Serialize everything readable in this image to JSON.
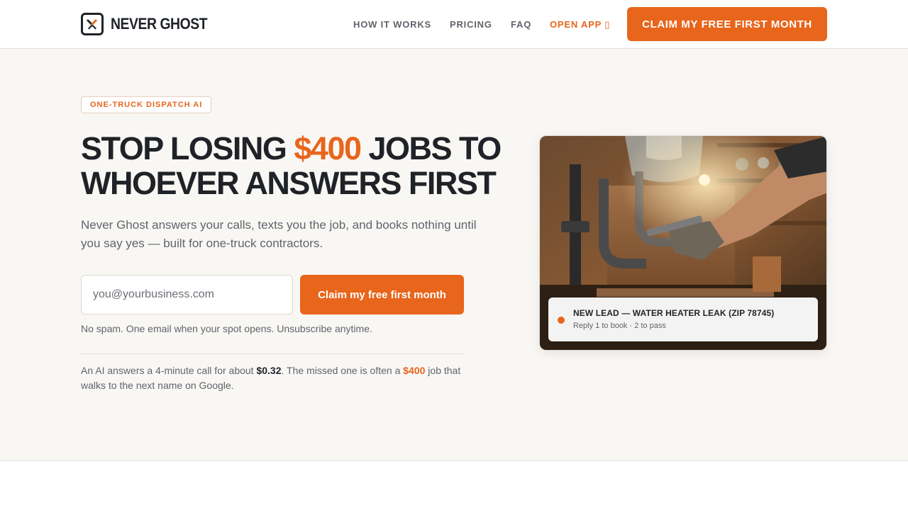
{
  "header": {
    "logo_text": "NEVER GHOST",
    "nav": [
      {
        "label": "HOW IT WORKS"
      },
      {
        "label": "PRICING"
      },
      {
        "label": "FAQ"
      },
      {
        "label": "OPEN APP ▯"
      }
    ],
    "cta_label": "CLAIM MY FREE FIRST MONTH"
  },
  "hero": {
    "badge": "ONE-TRUCK DISPATCH AI",
    "headline_pre": "STOP LOSING ",
    "headline_highlight": "$400",
    "headline_post": " JOBS TO WHOEVER ANSWERS FIRST",
    "subtext": "Never Ghost answers your calls, texts you the job, and books nothing until you say yes — built for one-truck contractors.",
    "email_placeholder": "you@yourbusiness.com",
    "claim_label": "Claim my free first month",
    "nospam": "No spam. One email when your spot opens. Unsubscribe anytime.",
    "cost_pre": "An AI answers a 4-minute call for about ",
    "cost_price": "$0.32",
    "cost_mid": ". The missed one is often a ",
    "cost_job": "$400",
    "cost_post": " job that walks to the next name on Google."
  },
  "lead_card": {
    "title": "NEW LEAD — WATER HEATER LEAK (ZIP 78745)",
    "subtitle": "Reply 1 to book · 2 to pass"
  },
  "colors": {
    "accent": "#e8651c",
    "text_dark": "#1f2328",
    "text_muted": "#5f646b",
    "hero_bg": "#f9f7f4"
  }
}
